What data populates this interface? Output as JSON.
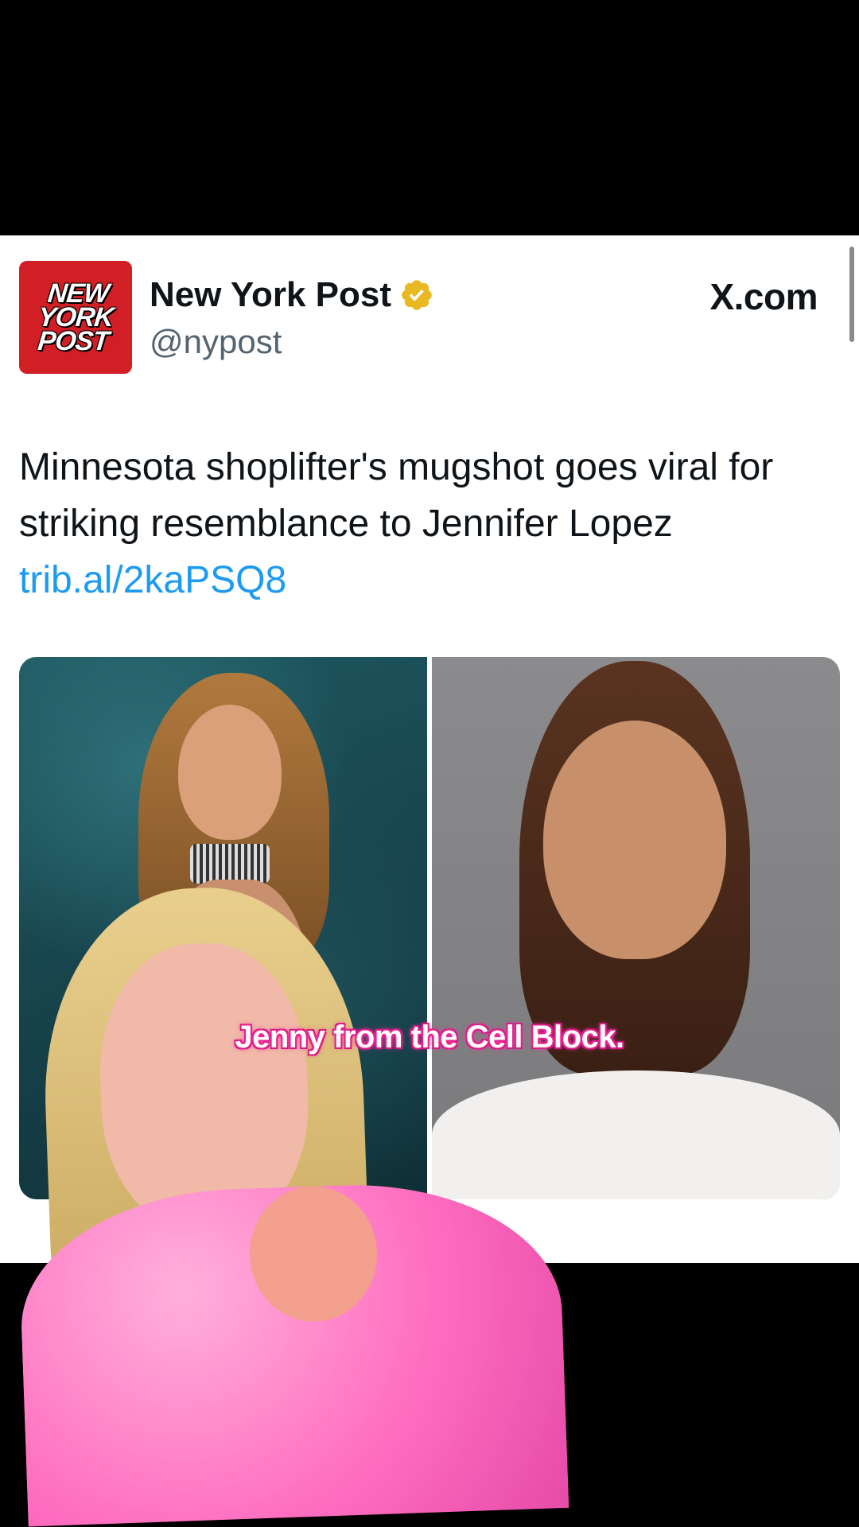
{
  "tweet": {
    "display_name": "New York Post",
    "handle": "@nypost",
    "brand": "X.com",
    "avatar_text": "NEW YORK POST",
    "text": "Minnesota shoplifter's mugshot goes viral for striking resemblance to Jennifer Lopez",
    "link": "trib.al/2kaPSQ8",
    "verified_color": "#e8b923"
  },
  "caption": {
    "text": "Jenny from the Cell Block."
  },
  "colors": {
    "link": "#1d9bf0",
    "avatar_bg": "#d21f26",
    "caption_glow": "#ff2fa0"
  }
}
